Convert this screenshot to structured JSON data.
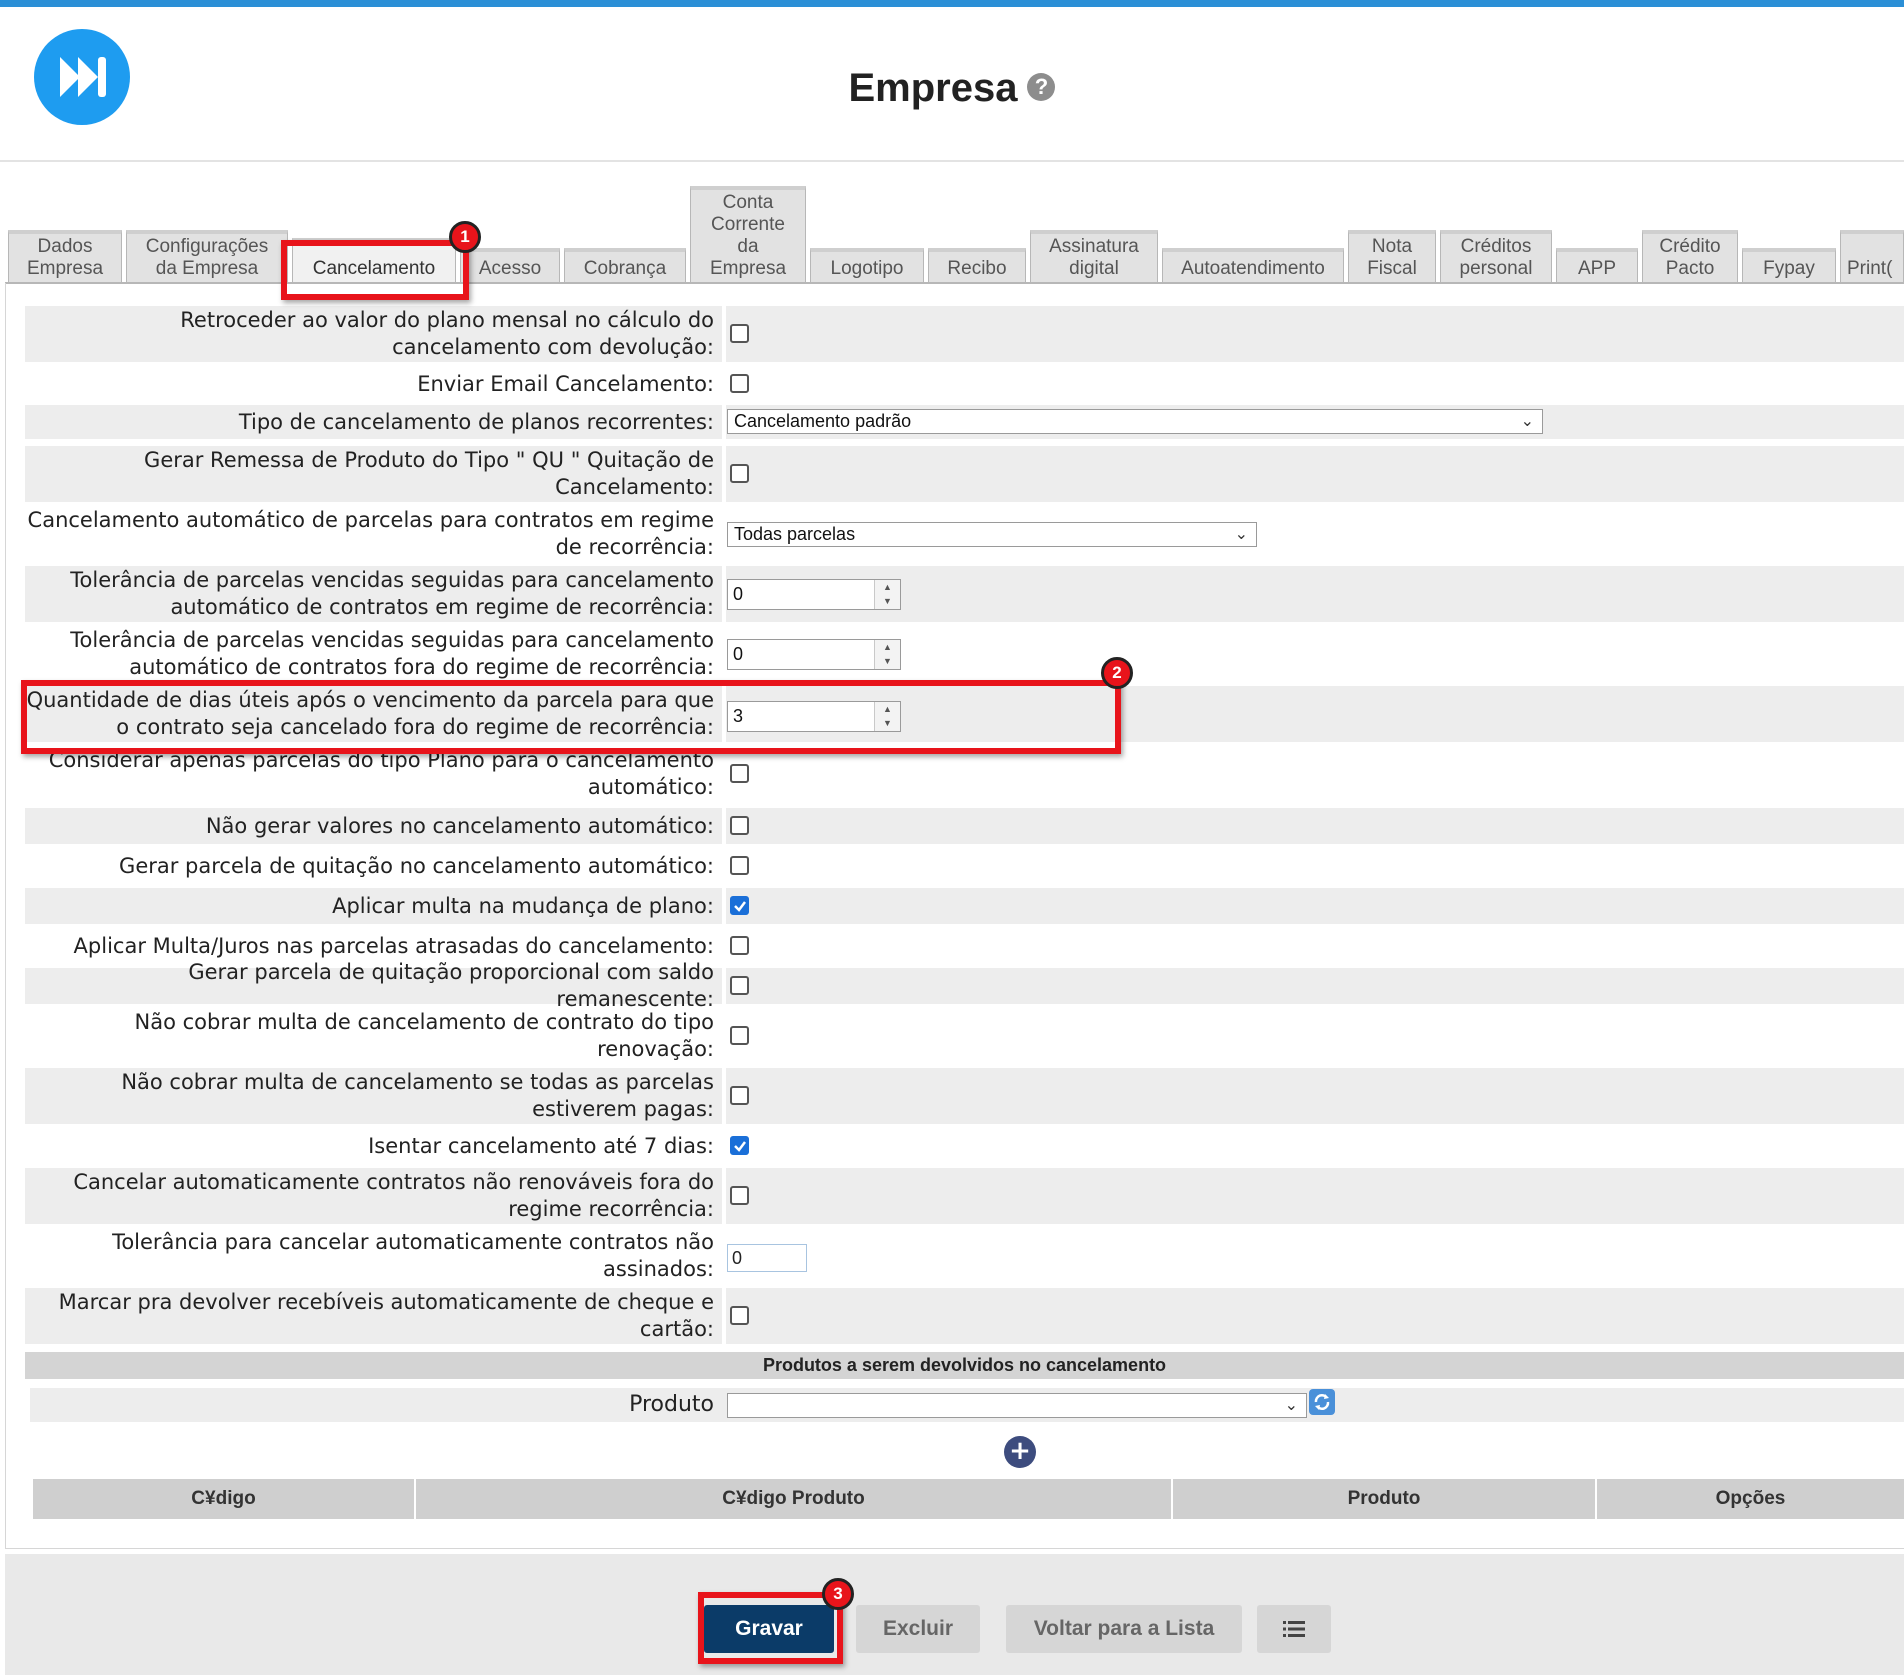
{
  "header": {
    "title": "Empresa",
    "help": "?"
  },
  "tabs": [
    {
      "label": "Dados\nEmpresa"
    },
    {
      "label": "Configurações\nda Empresa"
    },
    {
      "label": "Cancelamento"
    },
    {
      "label": "Acesso"
    },
    {
      "label": "Cobrança"
    },
    {
      "label": "Conta\nCorrente\nda\nEmpresa"
    },
    {
      "label": "Logotipo"
    },
    {
      "label": "Recibo"
    },
    {
      "label": "Assinatura\ndigital"
    },
    {
      "label": "Autoatendimento"
    },
    {
      "label": "Nota\nFiscal"
    },
    {
      "label": "Créditos\npersonal"
    },
    {
      "label": "APP"
    },
    {
      "label": "Crédito\nPacto"
    },
    {
      "label": "Fypay"
    },
    {
      "label": "Print("
    }
  ],
  "form": {
    "rows": [
      {
        "label": "Retroceder ao valor do plano mensal no cálculo do cancelamento com devolução:",
        "type": "checkbox",
        "checked": false
      },
      {
        "label": "Enviar Email Cancelamento:",
        "type": "checkbox",
        "checked": false
      },
      {
        "label": "Tipo de cancelamento de planos recorrentes:",
        "type": "select",
        "value": "Cancelamento padrão"
      },
      {
        "label": "Gerar Remessa de Produto do Tipo \" QU \" Quitação de Cancelamento:",
        "type": "checkbox",
        "checked": false
      },
      {
        "label": "Cancelamento automático de parcelas para contratos em regime de recorrência:",
        "type": "select",
        "value": "Todas parcelas"
      },
      {
        "label": "Tolerância de parcelas vencidas seguidas para cancelamento automático de contratos em regime de recorrência:",
        "type": "number",
        "value": "0"
      },
      {
        "label": "Tolerância de parcelas vencidas seguidas para cancelamento automático de contratos fora do regime de recorrência:",
        "type": "number",
        "value": "0"
      },
      {
        "label": "Quantidade de dias úteis após o vencimento da parcela para que o contrato seja cancelado fora do regime de recorrência:",
        "type": "number",
        "value": "3"
      },
      {
        "label": "Considerar apenas parcelas do tipo Plano para o cancelamento automático:",
        "type": "checkbox",
        "checked": false
      },
      {
        "label": "Não gerar valores no cancelamento automático:",
        "type": "checkbox",
        "checked": false
      },
      {
        "label": "Gerar parcela de quitação no cancelamento automático:",
        "type": "checkbox",
        "checked": false
      },
      {
        "label": "Aplicar multa na mudança de plano:",
        "type": "checkbox",
        "checked": true
      },
      {
        "label": "Aplicar Multa/Juros nas parcelas atrasadas do cancelamento:",
        "type": "checkbox",
        "checked": false
      },
      {
        "label": "Gerar parcela de quitação proporcional com saldo remanescente:",
        "type": "checkbox",
        "checked": false
      },
      {
        "label": "Não cobrar multa de cancelamento de contrato do tipo renovação:",
        "type": "checkbox",
        "checked": false
      },
      {
        "label": "Não cobrar multa de cancelamento se todas as parcelas estiverem pagas:",
        "type": "checkbox",
        "checked": false
      },
      {
        "label": "Isentar cancelamento até 7 dias:",
        "type": "checkbox",
        "checked": true
      },
      {
        "label": "Cancelar automaticamente contratos não renováveis fora do regime recorrência:",
        "type": "checkbox",
        "checked": false
      },
      {
        "label": "Tolerância para cancelar automaticamente contratos não assinados:",
        "type": "text",
        "value": "0"
      },
      {
        "label": "Marcar pra devolver recebíveis automaticamente de cheque e cartão:",
        "type": "checkbox",
        "checked": false
      }
    ]
  },
  "produtos": {
    "section_title": "Produtos a serem devolvidos no cancelamento",
    "produto_label": "Produto",
    "produto_value": "",
    "columns": [
      "C¥digo",
      "C¥digo Produto",
      "Produto",
      "Opções"
    ]
  },
  "footer": {
    "gravar": "Gravar",
    "excluir": "Excluir",
    "voltar": "Voltar para a Lista",
    "list_icon": "list-icon"
  },
  "annotations": [
    "1",
    "2",
    "3"
  ],
  "colors": {
    "accent": "#2b8fd6",
    "primary_button": "#0b3b68",
    "highlight": "#e8141b",
    "checkbox_checked": "#1a6fd8"
  }
}
